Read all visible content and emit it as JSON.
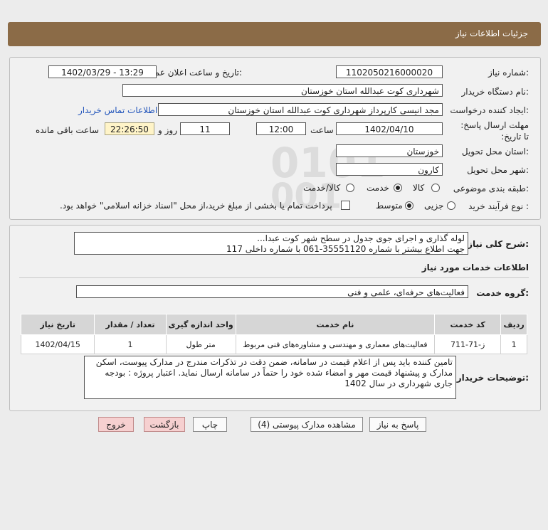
{
  "header": {
    "title": "جزئیات اطلاعات نیاز"
  },
  "form": {
    "need_number_label": "شماره نیاز:",
    "need_number": "1102050216000020",
    "announce_label": "تاریخ و ساعت اعلان عمومی:",
    "announce_value": "1402/03/29 - 13:29",
    "buyer_org_label": "نام دستگاه خریدار:",
    "buyer_org": "شهرداری کوت عبدالله استان خوزستان",
    "creator_label": "ایجاد کننده درخواست:",
    "creator": "مجد انیسی کارپرداز شهرداری کوت عبدالله استان خوزستان",
    "contact_link": "اطلاعات تماس خریدار",
    "deadline_label": "مهلت ارسال پاسخ: تا تاریخ:",
    "deadline_date": "1402/04/10",
    "time_label": "ساعت",
    "deadline_time": "12:00",
    "days_value": "11",
    "days_label": "روز و",
    "remaining_time": "22:26:50",
    "remaining_label": "ساعت باقی مانده",
    "province_label": "استان محل تحویل:",
    "province": "خوزستان",
    "city_label": "شهر محل تحویل:",
    "city": "کارون",
    "category_label": "طبقه بندی موضوعی:",
    "category_options": [
      "کالا",
      "خدمت",
      "کالا/خدمت"
    ],
    "category_selected": "خدمت",
    "process_label": "نوع فرآیند خرید :",
    "process_options": [
      "جزیی",
      "متوسط"
    ],
    "process_selected": "متوسط",
    "payment_note": "پرداخت تمام یا بخشی از مبلغ خرید،از محل \"اسناد خزانه اسلامی\" خواهد بود."
  },
  "summary": {
    "label": "شرح کلی نیاز:",
    "line1": "لوله گذاری و اجرای جوی جدول در سطح شهر کوت عبدا...",
    "line2": "جهت اطلاع بیشتر با شماره 35551120-061 با شماره داخلی 117"
  },
  "services": {
    "section_title": "اطلاعات خدمات مورد نیاز",
    "group_label": "گروه خدمت:",
    "group_value": "فعالیت‌های حرفه‌ای، علمی و فنی",
    "columns": [
      "ردیف",
      "کد خدمت",
      "نام خدمت",
      "واحد اندازه گیری",
      "تعداد / مقدار",
      "تاریخ نیاز"
    ],
    "rows": [
      [
        "1",
        "ز-71-711",
        "فعالیت‌های معماری و مهندسی و مشاوره‌های فنی مربوط",
        "متر طول",
        "1",
        "1402/04/15"
      ]
    ]
  },
  "buyer_notes": {
    "label": "توضیحات خریدار:",
    "text": "تامین کننده باید پس از اعلام قیمت در سامانه، ضمن دقت در تذکرات مندرج در مدارک پیوست، اسکن مدارک و پیشنهاد قیمت مهر و امضاء شده خود را حتماً در سامانه ارسال نماید. اعتبار پروژه : بودجه جاری شهرداری در سال 1402"
  },
  "buttons": {
    "reply": "پاسخ به نیاز",
    "attachments": "مشاهده مدارک پیوستی (4)",
    "print": "چاپ",
    "back": "بازگشت",
    "exit": "خروج"
  },
  "watermark": {
    "brand": "ParsNamadData",
    "line1": "مرکز فراهم آوری اطلاعات پارس نماد داده",
    "line2": "پایگاه اطلاع رسانی مناقصه و مزایده",
    "phone": "۰۲۱-۸۸۳۴۹۶۷۰"
  },
  "colors": {
    "header_bg": "#8b6b47",
    "link": "#2255bb",
    "remaining_bg": "#fff4c8",
    "exit_bg": "#f6d0d0"
  }
}
